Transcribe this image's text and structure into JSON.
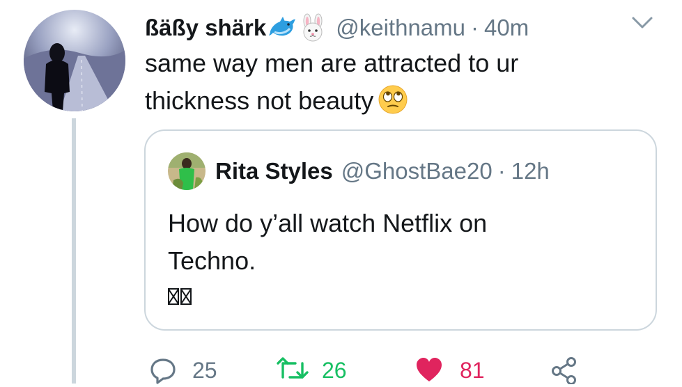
{
  "tweet": {
    "display_name": "ßäßy shärk",
    "name_emojis": [
      "dolphin-emoji",
      "rabbit-face-emoji"
    ],
    "handle": "@keithnamu",
    "separator": "·",
    "timestamp": "40m",
    "text_lines": [
      "same way men are attracted to ur",
      "thickness not beauty"
    ],
    "text_emoji": "face-with-rolling-eyes-emoji"
  },
  "quoted_tweet": {
    "display_name": "Rita Styles",
    "handle": "@GhostBae20",
    "separator": "·",
    "timestamp": "12h",
    "text_lines": [
      "How do y’all watch Netflix on",
      "Techno."
    ],
    "unrendered_glyphs": 2
  },
  "actions": {
    "reply_count": "25",
    "retweet_count": "26",
    "like_count": "81"
  },
  "colors": {
    "text": "#14171a",
    "secondary": "#657786",
    "border": "#ccd6dd",
    "retweet_green": "#17bf63",
    "like_red": "#e0245e"
  }
}
